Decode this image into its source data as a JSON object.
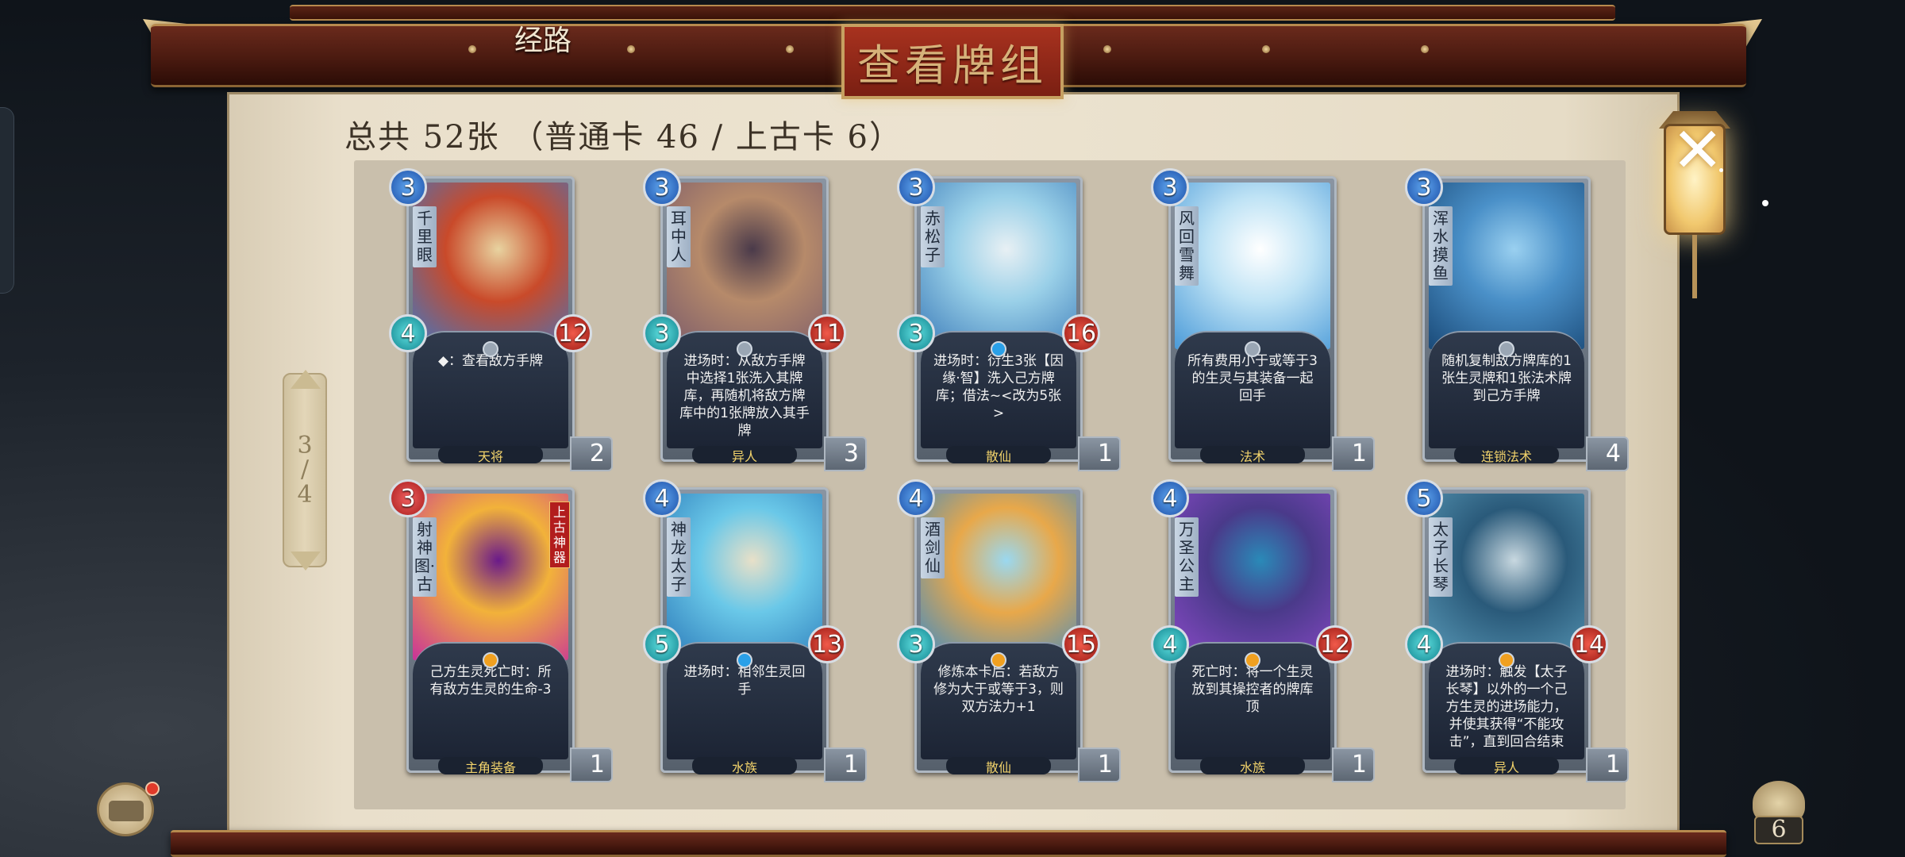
{
  "header": {
    "page_label": "经路",
    "title": "查看牌组",
    "summary": "总共  52张    （普通卡 46 / 上古卡 6）"
  },
  "pager": {
    "current": "3",
    "separator": "/",
    "total": "4"
  },
  "close_symbol": "✕",
  "deck_count": "6",
  "cards": [
    {
      "name": "千里眼",
      "cost": "3",
      "attack": "4",
      "health": "12",
      "desc": "◆：查看敌方手牌",
      "race": "天将",
      "copies": "2",
      "art_colors": [
        "#c94a2a",
        "#3a78c8",
        "#e8d3a0"
      ],
      "gem": "#9aa6b4"
    },
    {
      "name": "耳中人",
      "cost": "3",
      "attack": "3",
      "health": "11",
      "desc": "进场时：从敌方手牌中选择1张洗入其牌库，再随机将敌方牌库中的1张牌放入其手牌",
      "race": "异人",
      "copies": "3",
      "art_colors": [
        "#b68a6a",
        "#7a5a6a",
        "#4a3a4a"
      ],
      "gem": "#9aa6b4"
    },
    {
      "name": "赤松子",
      "cost": "3",
      "attack": "3",
      "health": "16",
      "desc": "进场时：衍生3张【因缘·智】洗入己方牌库；借法~<改为5张>",
      "race": "散仙",
      "copies": "1",
      "art_colors": [
        "#9ad0e8",
        "#3a7ab8",
        "#e8f0f4"
      ],
      "gem": "#2aa0e8"
    },
    {
      "name": "风回雪舞",
      "cost": "3",
      "attack": "",
      "health": "",
      "desc": "所有费用小于或等于3的生灵与其装备一起回手",
      "race": "法术",
      "copies": "1",
      "art_colors": [
        "#bfe3f5",
        "#4a9ad8",
        "#ffffff"
      ],
      "gem": "#9aa6b4"
    },
    {
      "name": "浑水摸鱼",
      "cost": "3",
      "attack": "",
      "health": "",
      "desc": "随机复制敌方牌库的1张生灵牌和1张法术牌到己方手牌",
      "race": "连锁法术",
      "copies": "4",
      "art_colors": [
        "#4a90c8",
        "#1a4a78",
        "#9ad0f0"
      ],
      "gem": "#9aa6b4"
    },
    {
      "name": "射神图·古",
      "cost": "3",
      "cost_red": true,
      "ancient": "上古神器",
      "attack": "",
      "health": "",
      "desc": "己方生灵死亡时：所有敌方生灵的生命-3",
      "race": "主角装备",
      "copies": "1",
      "art_colors": [
        "#f2b23a",
        "#c8329a",
        "#6a1a8a"
      ],
      "gem": "#f0a020"
    },
    {
      "name": "神龙太子",
      "cost": "4",
      "attack": "5",
      "health": "13",
      "desc": "进场时：相邻生灵回手",
      "race": "水族",
      "copies": "1",
      "art_colors": [
        "#6ac8e8",
        "#2a78b8",
        "#e8e0c8"
      ],
      "gem": "#2aa0e8"
    },
    {
      "name": "酒剑仙",
      "cost": "4",
      "attack": "3",
      "health": "15",
      "desc": "修炼本卡后：若敌方修为大于或等于3，则双方法力+1",
      "race": "散仙",
      "copies": "1",
      "art_colors": [
        "#e8a84a",
        "#3a8ac8",
        "#9ad8f0"
      ],
      "gem": "#f0a020"
    },
    {
      "name": "万圣公主",
      "cost": "4",
      "attack": "4",
      "health": "12",
      "desc": "死亡时：将一个生灵放到其操控者的牌库顶",
      "race": "水族",
      "copies": "1",
      "art_colors": [
        "#4a3a8a",
        "#8a4ac8",
        "#2a8ab8"
      ],
      "gem": "#f0a020"
    },
    {
      "name": "太子长琴",
      "cost": "5",
      "attack": "4",
      "health": "14",
      "desc": "进场时：触发【太子长琴】以外的一个己方生灵的进场能力，并使其获得“不能攻击”，直到回合结束",
      "race": "异人",
      "copies": "1",
      "art_colors": [
        "#2a5a7a",
        "#5a9ab8",
        "#c8d8e0"
      ],
      "gem": "#f0a020"
    }
  ]
}
